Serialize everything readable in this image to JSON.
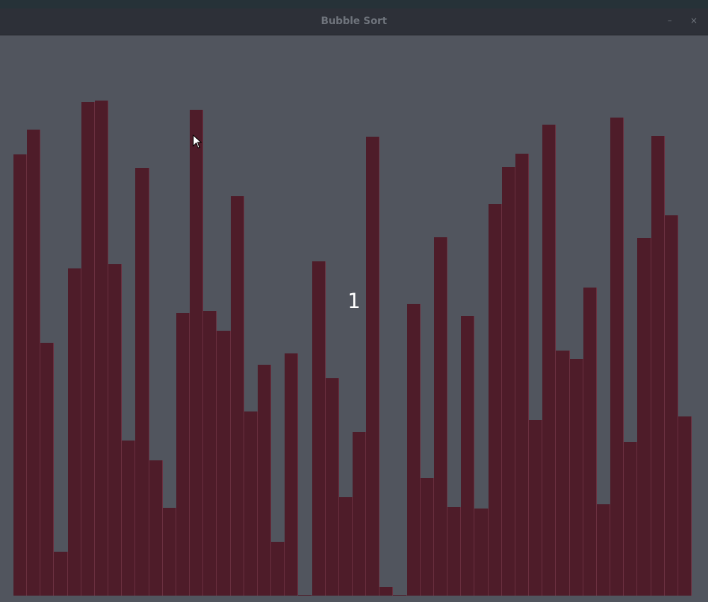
{
  "window": {
    "title": "Bubble Sort",
    "minimize_glyph": "–",
    "close_glyph": "×"
  },
  "visualizer": {
    "pass_counter": "1",
    "bar_color": "#4e1c29",
    "background_color": "#51555e",
    "max_value": 697,
    "values": [
      622,
      657,
      356,
      62,
      461,
      696,
      698,
      467,
      219,
      603,
      191,
      124,
      398,
      685,
      401,
      373,
      563,
      260,
      326,
      76,
      342,
      1,
      471,
      307,
      139,
      231,
      647,
      12,
      0,
      411,
      166,
      505,
      125,
      394,
      123,
      552,
      604,
      623,
      248,
      664,
      346,
      334,
      434,
      129,
      674,
      217,
      504,
      648,
      536,
      253
    ]
  },
  "cursor": {
    "icon": "arrow-cursor-icon"
  }
}
